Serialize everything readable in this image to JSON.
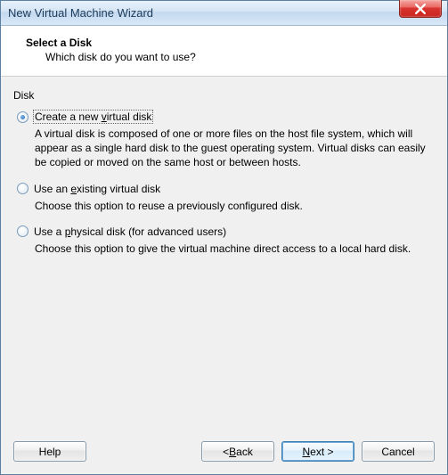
{
  "window": {
    "title": "New Virtual Machine Wizard"
  },
  "header": {
    "title": "Select a Disk",
    "subtitle": "Which disk do you want to use?"
  },
  "group_label": "Disk",
  "options": {
    "create": {
      "label_pre": "Create a new ",
      "label_accel": "v",
      "label_post": "irtual disk",
      "desc": "A virtual disk is composed of one or more files on the host file system, which will appear as a single hard disk to the guest operating system. Virtual disks can easily be copied or moved on the same host or between hosts."
    },
    "existing": {
      "label_pre": "Use an ",
      "label_accel": "e",
      "label_post": "xisting virtual disk",
      "desc": "Choose this option to reuse a previously configured disk."
    },
    "physical": {
      "label_pre": "Use a ",
      "label_accel": "p",
      "label_post": "hysical disk (for advanced users)",
      "desc": "Choose this option to give the virtual machine direct access to a local hard disk."
    }
  },
  "buttons": {
    "help": "Help",
    "back_pre": "< ",
    "back_accel": "B",
    "back_post": "ack",
    "next_pre": "",
    "next_accel": "N",
    "next_post": "ext >",
    "cancel": "Cancel"
  }
}
